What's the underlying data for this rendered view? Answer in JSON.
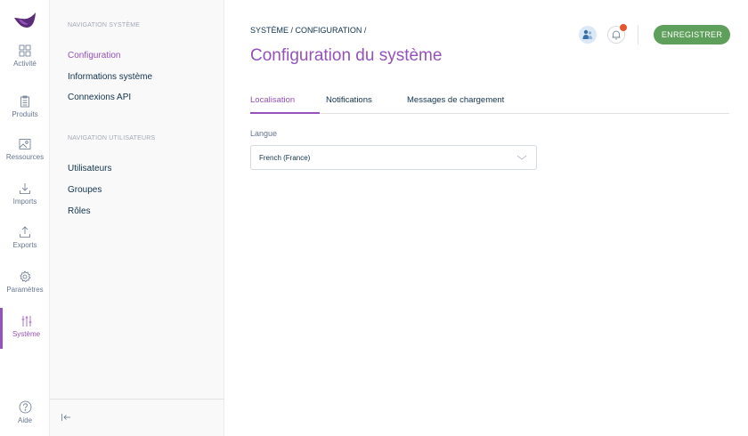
{
  "rail": {
    "items": [
      {
        "label": "Activité",
        "icon": "dashboard-grid-icon"
      },
      {
        "label": "Produits",
        "icon": "clipboard-icon"
      },
      {
        "label": "Ressources",
        "icon": "image-icon"
      },
      {
        "label": "Imports",
        "icon": "import-icon"
      },
      {
        "label": "Exports",
        "icon": "export-icon"
      },
      {
        "label": "Paramètres",
        "icon": "gear-icon"
      },
      {
        "label": "Système",
        "icon": "sliders-icon"
      }
    ],
    "help_label": "Aide"
  },
  "subnav": {
    "system_heading": "NAVIGATION SYSTÈME",
    "system_items": [
      {
        "label": "Configuration"
      },
      {
        "label": "Informations système"
      },
      {
        "label": "Connexions API"
      }
    ],
    "users_heading": "NAVIGATION UTILISATEURS",
    "users_items": [
      {
        "label": "Utilisateurs"
      },
      {
        "label": "Groupes"
      },
      {
        "label": "Rôles"
      }
    ]
  },
  "header": {
    "breadcrumb": "SYSTÈME / CONFIGURATION /",
    "title": "Configuration du système",
    "save_label": "ENREGISTRER"
  },
  "tabs": [
    {
      "label": "Localisation"
    },
    {
      "label": "Notifications"
    },
    {
      "label": "Messages de chargement"
    }
  ],
  "form": {
    "language_label": "Langue",
    "language_value": "French (France)"
  },
  "colors": {
    "accent": "#9452ba",
    "save": "#5e9f5b",
    "notification_dot": "#e4572e"
  }
}
